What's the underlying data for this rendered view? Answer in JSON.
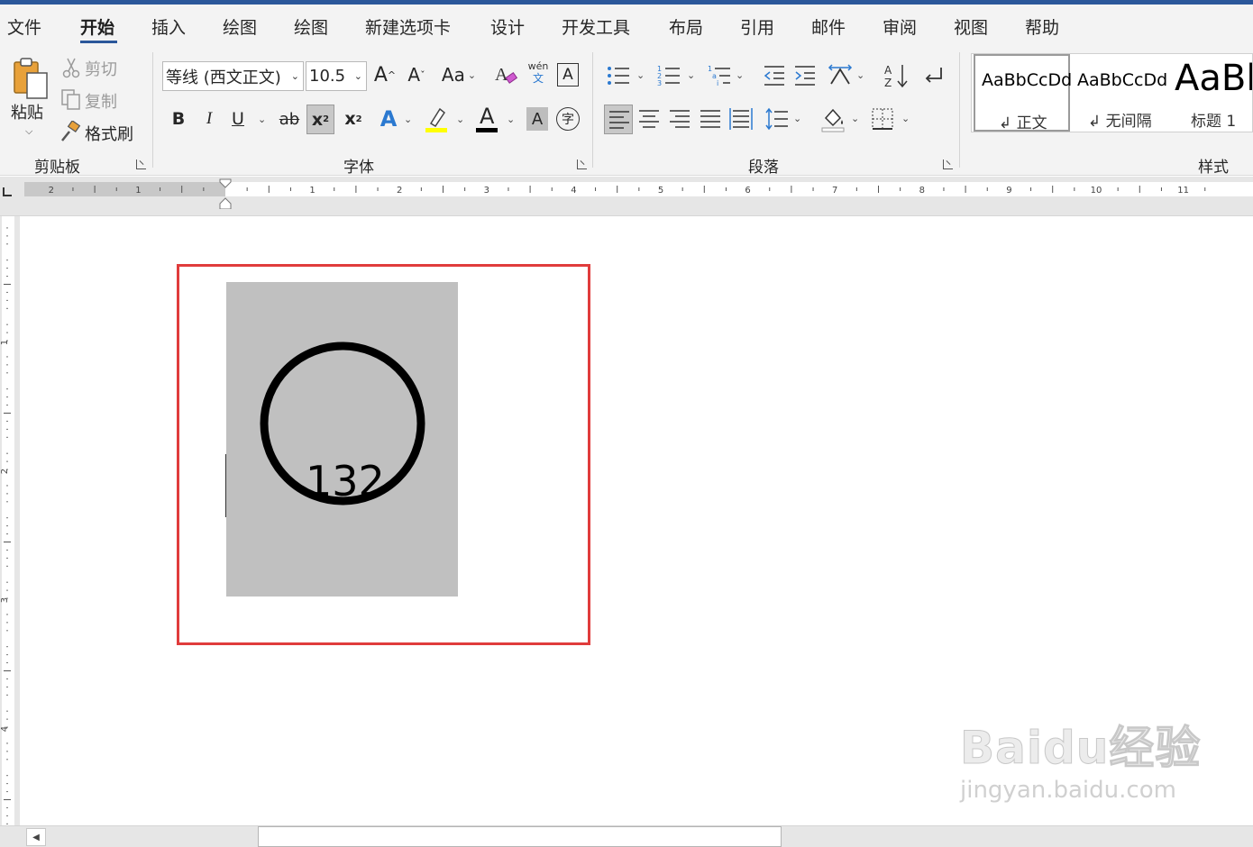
{
  "tabs": [
    {
      "label": "文件",
      "active": false
    },
    {
      "label": "开始",
      "active": true
    },
    {
      "label": "插入",
      "active": false
    },
    {
      "label": "绘图",
      "active": false
    },
    {
      "label": "绘图",
      "active": false
    },
    {
      "label": "新建选项卡",
      "active": false
    },
    {
      "label": "设计",
      "active": false
    },
    {
      "label": "开发工具",
      "active": false
    },
    {
      "label": "布局",
      "active": false
    },
    {
      "label": "引用",
      "active": false
    },
    {
      "label": "邮件",
      "active": false
    },
    {
      "label": "审阅",
      "active": false
    },
    {
      "label": "视图",
      "active": false
    },
    {
      "label": "帮助",
      "active": false
    }
  ],
  "clipboard": {
    "paste": "粘贴",
    "cut": "剪切",
    "copy": "复制",
    "format_painter": "格式刷",
    "group_label": "剪贴板"
  },
  "font": {
    "name": "等线 (西文正文)",
    "size": "10.5",
    "group_label": "字体",
    "phonetic_top": "wén",
    "phonetic_bottom": "文",
    "bold": "B",
    "italic": "I",
    "underline": "U",
    "strikethrough": "ab",
    "subscript": "x",
    "subscript_mark": "2",
    "superscript": "x",
    "superscript_mark": "2",
    "case": "Aa",
    "text_effect": "A",
    "font_color": "A",
    "char_shading": "A",
    "enclose": "字",
    "highlight_color": "#ffff00",
    "font_color_value": "#000000",
    "effect_color": "#2b79d0"
  },
  "paragraph": {
    "group_label": "段落"
  },
  "styles": {
    "group_label": "样式",
    "items": [
      {
        "sample": "AaBbCcDd",
        "name": "正文",
        "selected": true
      },
      {
        "sample": "AaBbCcDd",
        "name": "无间隔",
        "selected": false
      },
      {
        "sample": "AaBl",
        "name": "标题 1",
        "selected": false
      }
    ]
  },
  "ruler": {
    "h_labels": [
      "2",
      "1",
      "1",
      "2",
      "3",
      "4",
      "5",
      "6",
      "7",
      "8",
      "9",
      "10",
      "11"
    ],
    "v_labels": [
      "1",
      "2",
      "3",
      "4"
    ]
  },
  "document": {
    "shape_text": "132",
    "highlight_border_color": "#e03c3c",
    "shape_fill": "#c0c0c0"
  },
  "watermark": {
    "main": "Baidu经验",
    "sub": "jingyan.baidu.com"
  }
}
